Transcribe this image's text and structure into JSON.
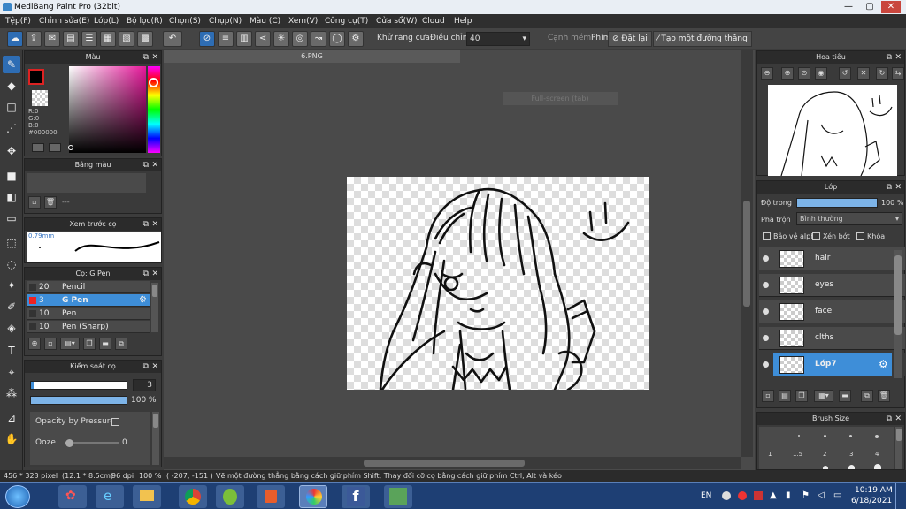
{
  "title": "MediBang Paint Pro (32bit)",
  "window_controls": {
    "minimize": "—",
    "maximize": "▢",
    "close": "✕"
  },
  "menu": [
    "Tệp(F)",
    "Chỉnh sửa(E)",
    "Lớp(L)",
    "Bộ lọc(R)",
    "Chọn(S)",
    "Chụp(N)",
    "Màu (C)",
    "Xem(V)",
    "Công cụ(T)",
    "Cửa sổ(W)",
    "Cloud",
    "Help"
  ],
  "toolbar": {
    "antialias_label": "Khử răng cưa",
    "adjust_label": "Điều chỉnh",
    "adjust_value": "40",
    "soft_edge_label": "Cạnh mềm",
    "key_label": "Phím",
    "reset_label": "Đặt lại",
    "line_label": "Tạo một đường thẳng"
  },
  "color_panel": {
    "title": "Màu",
    "r": "R:0",
    "g": "G:0",
    "b": "B:0",
    "hex": "#000000"
  },
  "palette_panel": {
    "title": "Bảng màu",
    "placeholder": "---"
  },
  "brush_preview": {
    "title": "Xem trước cọ",
    "size": "0.79mm"
  },
  "brush_panel": {
    "title": "Cọ: G Pen",
    "items": [
      {
        "size": "20",
        "name": "Pencil",
        "color": "#333333"
      },
      {
        "size": "3",
        "name": "G Pen",
        "color": "#ee2222"
      },
      {
        "size": "10",
        "name": "Pen",
        "color": "#333333"
      },
      {
        "size": "10",
        "name": "Pen (Sharp)",
        "color": "#333333"
      }
    ]
  },
  "brush_control": {
    "title": "Kiểm soát cọ",
    "size_value": "3",
    "opacity_value": "100 %",
    "opacity_fraction": 1.0,
    "pressure_label": "Opacity by Pressure",
    "ooze_label": "Ooze",
    "ooze_value": "0",
    "ooze_fraction": 0.0
  },
  "document": {
    "tab": "6.PNG",
    "fullscreen_label": "Full-screen (tab)"
  },
  "navigator": {
    "title": "Hoa tiêu"
  },
  "layers_panel": {
    "title": "Lớp",
    "opacity_label": "Độ trong",
    "opacity_value": "100 %",
    "opacity_fraction": 1.0,
    "blend_label": "Pha trộn",
    "blend_value": "Bình thường",
    "protect_alpha": "Bảo vệ alpha",
    "clipping": "Xén bớt",
    "lock": "Khóa",
    "layers": [
      {
        "name": "hair",
        "selected": false
      },
      {
        "name": "eyes",
        "selected": false
      },
      {
        "name": "face",
        "selected": false
      },
      {
        "name": "clths",
        "selected": false
      },
      {
        "name": "Lớp7",
        "selected": true
      }
    ]
  },
  "brush_size": {
    "title": "Brush Size",
    "sizes": [
      "1",
      "1.5",
      "2",
      "3",
      "4"
    ]
  },
  "status": {
    "dimensions": "456 * 323 pixel",
    "physical": "(12.1 * 8.5cm)",
    "dpi": "96 dpi",
    "zoom": "100 %",
    "coords": "( -207, -151 )",
    "hint": "Vẽ một đường thẳng bằng cách giữ phím Shift, Thay đổi cỡ cọ bằng cách giữ phím Ctrl, Alt và kéo"
  },
  "taskbar": {
    "lang": "EN",
    "time": "10:19 AM",
    "date": "6/18/2021"
  },
  "colors": {
    "accent": "#3e8ed8",
    "panel": "#3a3a3a",
    "header": "#2b2b2b",
    "taskbar": "#1e3f74"
  }
}
